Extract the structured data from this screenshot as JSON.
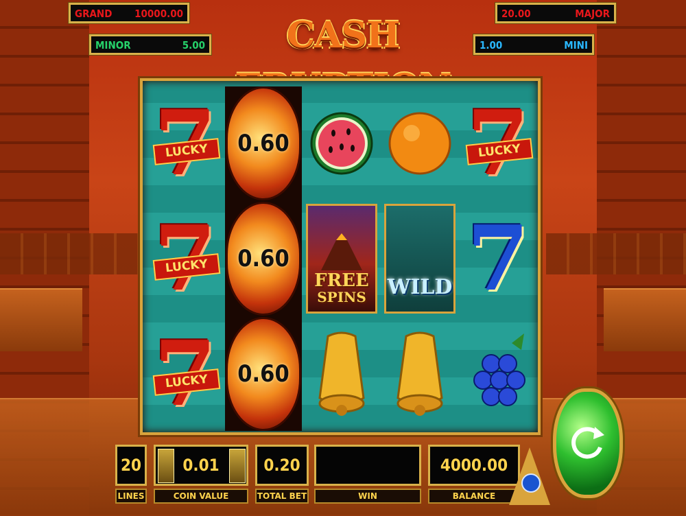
{
  "title": "CASH ERUPTION",
  "jackpots": {
    "grand": {
      "label": "GRAND",
      "value": "10000.00"
    },
    "major": {
      "label": "MAJOR",
      "value": "20.00"
    },
    "minor": {
      "label": "MINOR",
      "value": "5.00"
    },
    "mini": {
      "label": "MINI",
      "value": "1.00"
    }
  },
  "colors": {
    "grand": "#e8171b",
    "major": "#e8171b",
    "minor": "#26d26a",
    "mini": "#2ab8ff",
    "panel_text": "#ffd34d"
  },
  "reels": [
    [
      "lucky-7-red",
      "lucky-7-red",
      "lucky-7-red"
    ],
    [
      "fireball-coin",
      "fireball-coin",
      "fireball-coin"
    ],
    [
      "watermelon",
      "free-spins",
      "bell"
    ],
    [
      "orange",
      "wild",
      "bell"
    ],
    [
      "lucky-7-red",
      "seven-blue",
      "blueberries"
    ]
  ],
  "symbol_text": {
    "seven": "7",
    "lucky": "LUCKY",
    "coin_value": "0.60",
    "free": "FREE",
    "spins": "SPINS",
    "wild": "WILD"
  },
  "controls": {
    "lines": {
      "value": "20",
      "label": "LINES"
    },
    "coin_value": {
      "value": "0.01",
      "label": "COIN VALUE"
    },
    "total_bet": {
      "value": "0.20",
      "label": "TOTAL BET"
    },
    "win": {
      "value": "",
      "label": "WIN"
    },
    "balance": {
      "value": "4000.00",
      "label": "BALANCE"
    }
  }
}
